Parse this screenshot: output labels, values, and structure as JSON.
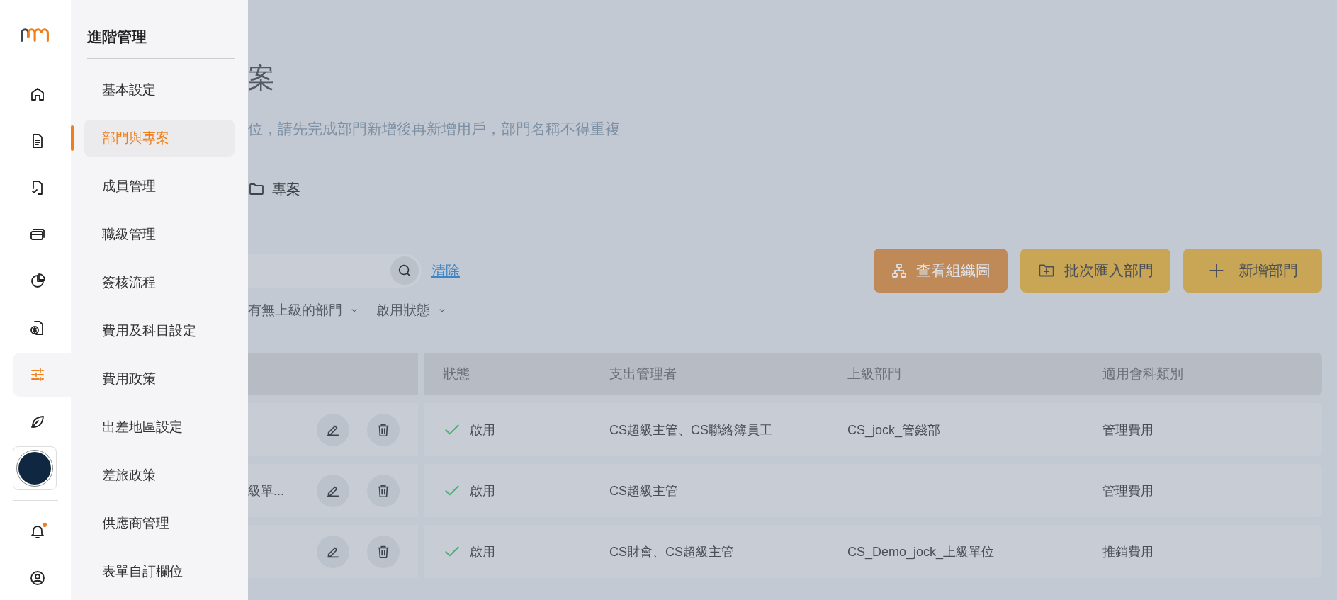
{
  "rail": {
    "items": [
      {
        "kind": "home",
        "selected": false
      },
      {
        "kind": "document",
        "selected": false
      },
      {
        "kind": "approval",
        "selected": false
      },
      {
        "kind": "card",
        "selected": false
      },
      {
        "kind": "chart",
        "selected": false
      },
      {
        "kind": "invoice",
        "selected": false
      },
      {
        "kind": "sliders",
        "selected": true
      },
      {
        "kind": "leaf",
        "selected": false
      },
      {
        "kind": "avatar"
      }
    ],
    "bottom_items": [
      {
        "kind": "bell",
        "unread": true
      },
      {
        "kind": "user"
      }
    ]
  },
  "flyout": {
    "title": "進階管理",
    "items": [
      {
        "label": "基本設定",
        "selected": false
      },
      {
        "label": "部門與專案",
        "selected": true
      },
      {
        "label": "成員管理",
        "selected": false
      },
      {
        "label": "職級管理",
        "selected": false
      },
      {
        "label": "簽核流程",
        "selected": false
      },
      {
        "label": "費用及科目設定",
        "selected": false
      },
      {
        "label": "費用政策",
        "selected": false
      },
      {
        "label": "出差地區設定",
        "selected": false
      },
      {
        "label": "差旅政策",
        "selected": false
      },
      {
        "label": "供應商管理",
        "selected": false
      },
      {
        "label": "表單自訂欄位",
        "selected": false
      }
    ]
  },
  "main": {
    "title": "案",
    "subtitle": "位，請先完成部門新增後再新增用戶，部門名稱不得重複",
    "tab": {
      "label": "專案"
    },
    "search": {
      "clear": "清除"
    },
    "filters": [
      "有無上級的部門",
      "啟用狀態"
    ],
    "buttons": [
      {
        "kind": "org",
        "label": "查看組織圖"
      },
      {
        "kind": "import",
        "label": "批次匯入部門"
      },
      {
        "kind": "add",
        "label": "新增部門"
      }
    ],
    "table": {
      "columns": [
        "狀態",
        "支出管理者",
        "上級部門",
        "適用會科類別"
      ],
      "rows": [
        {
          "enabled": true,
          "status": "啟用",
          "manager": "CS超級主管、CS聯絡簿員工",
          "parent": "CS_jock_管錢部",
          "category": "管理費用"
        },
        {
          "name": "級單...",
          "enabled": true,
          "status": "啟用",
          "manager": "CS超級主管",
          "category": "管理費用"
        },
        {
          "enabled": true,
          "status": "啟用",
          "manager": "CS財會、CS超級主管",
          "parent": "CS_Demo_jock_上級單位",
          "category": "推銷費用"
        }
      ]
    }
  }
}
